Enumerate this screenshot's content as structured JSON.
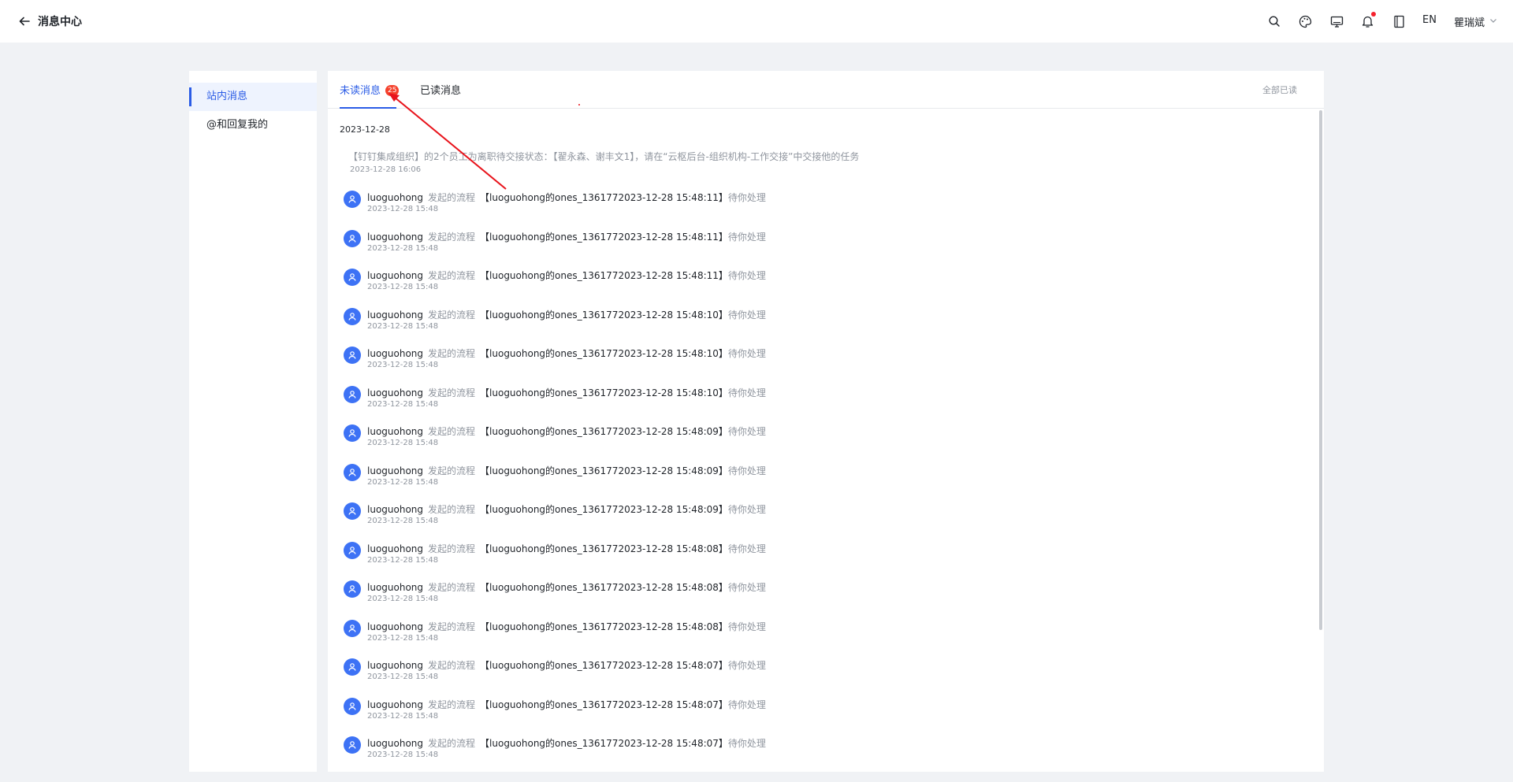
{
  "header": {
    "title": "消息中心",
    "lang": "EN",
    "user": "瞿瑞斌",
    "icons": [
      "search-icon",
      "palette-icon",
      "monitor-icon",
      "bell-icon",
      "book-icon"
    ]
  },
  "sidebar": {
    "items": [
      {
        "label": "站内消息",
        "active": true
      },
      {
        "label": "@和回复我的",
        "active": false
      }
    ]
  },
  "tabs": {
    "unread_label": "未读消息",
    "unread_count": "25",
    "read_label": "已读消息",
    "mark_all_read": "全部已读"
  },
  "group": {
    "date": "2023-12-28",
    "system_message": {
      "text": "【钉钉集成组织】的2个员工为离职待交接状态：【翟永森、谢丰文1】，请在“云枢后台-组织机构-工作交接”中交接他的任务",
      "time": "2023-12-28 16:06"
    },
    "messages": [
      {
        "user": "luoguohong",
        "verb": "发起的流程",
        "title": "【luoguohong的ones_1361772023-12-28 15:48:11】",
        "status": "待你处理",
        "time": "2023-12-28 15:48"
      },
      {
        "user": "luoguohong",
        "verb": "发起的流程",
        "title": "【luoguohong的ones_1361772023-12-28 15:48:11】",
        "status": "待你处理",
        "time": "2023-12-28 15:48"
      },
      {
        "user": "luoguohong",
        "verb": "发起的流程",
        "title": "【luoguohong的ones_1361772023-12-28 15:48:11】",
        "status": "待你处理",
        "time": "2023-12-28 15:48"
      },
      {
        "user": "luoguohong",
        "verb": "发起的流程",
        "title": "【luoguohong的ones_1361772023-12-28 15:48:10】",
        "status": "待你处理",
        "time": "2023-12-28 15:48"
      },
      {
        "user": "luoguohong",
        "verb": "发起的流程",
        "title": "【luoguohong的ones_1361772023-12-28 15:48:10】",
        "status": "待你处理",
        "time": "2023-12-28 15:48"
      },
      {
        "user": "luoguohong",
        "verb": "发起的流程",
        "title": "【luoguohong的ones_1361772023-12-28 15:48:10】",
        "status": "待你处理",
        "time": "2023-12-28 15:48"
      },
      {
        "user": "luoguohong",
        "verb": "发起的流程",
        "title": "【luoguohong的ones_1361772023-12-28 15:48:09】",
        "status": "待你处理",
        "time": "2023-12-28 15:48"
      },
      {
        "user": "luoguohong",
        "verb": "发起的流程",
        "title": "【luoguohong的ones_1361772023-12-28 15:48:09】",
        "status": "待你处理",
        "time": "2023-12-28 15:48"
      },
      {
        "user": "luoguohong",
        "verb": "发起的流程",
        "title": "【luoguohong的ones_1361772023-12-28 15:48:09】",
        "status": "待你处理",
        "time": "2023-12-28 15:48"
      },
      {
        "user": "luoguohong",
        "verb": "发起的流程",
        "title": "【luoguohong的ones_1361772023-12-28 15:48:08】",
        "status": "待你处理",
        "time": "2023-12-28 15:48"
      },
      {
        "user": "luoguohong",
        "verb": "发起的流程",
        "title": "【luoguohong的ones_1361772023-12-28 15:48:08】",
        "status": "待你处理",
        "time": "2023-12-28 15:48"
      },
      {
        "user": "luoguohong",
        "verb": "发起的流程",
        "title": "【luoguohong的ones_1361772023-12-28 15:48:08】",
        "status": "待你处理",
        "time": "2023-12-28 15:48"
      },
      {
        "user": "luoguohong",
        "verb": "发起的流程",
        "title": "【luoguohong的ones_1361772023-12-28 15:48:07】",
        "status": "待你处理",
        "time": "2023-12-28 15:48"
      },
      {
        "user": "luoguohong",
        "verb": "发起的流程",
        "title": "【luoguohong的ones_1361772023-12-28 15:48:07】",
        "status": "待你处理",
        "time": "2023-12-28 15:48"
      },
      {
        "user": "luoguohong",
        "verb": "发起的流程",
        "title": "【luoguohong的ones_1361772023-12-28 15:48:07】",
        "status": "待你处理",
        "time": "2023-12-28 15:48"
      }
    ]
  },
  "colors": {
    "accent": "#2b5ce6",
    "badge": "#f5412c",
    "avatar": "#3d72f5",
    "annotation": "#e8141c"
  }
}
